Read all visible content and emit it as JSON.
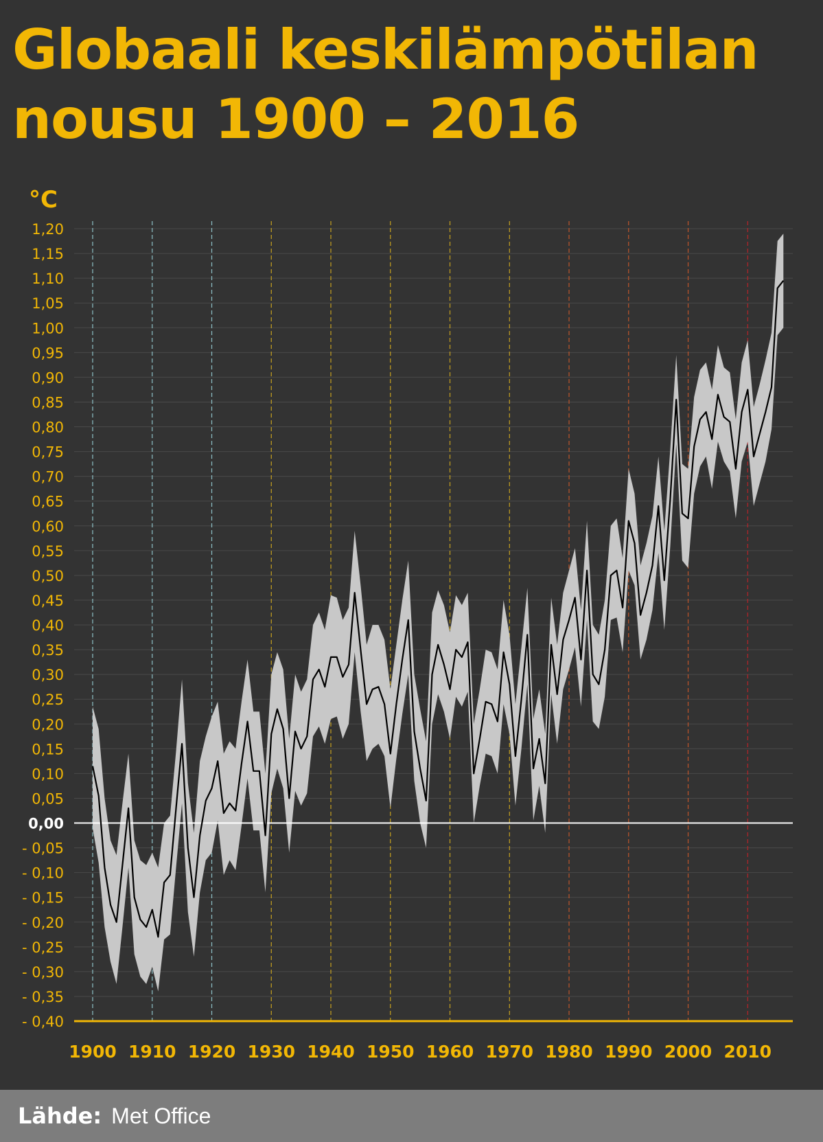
{
  "title": {
    "line1": "Globaali keskilämpötilan",
    "line2": "nousu 1900 – 2016"
  },
  "footer": {
    "source_label": "Lähde:",
    "source_value": "Met Office"
  },
  "colors": {
    "background": "#333333",
    "accent": "#f2b705",
    "band": "#c8c8c8",
    "line": "#000000",
    "zero_line": "#ffffff",
    "footer": "#7d7d7d"
  },
  "chart_data": {
    "type": "line",
    "ylabel": "°C",
    "ylim": [
      -0.4,
      1.2
    ],
    "xlim": [
      1900,
      2016
    ],
    "yticks": [
      {
        "v": 1.2,
        "label": "1,20"
      },
      {
        "v": 1.15,
        "label": "1,15"
      },
      {
        "v": 1.1,
        "label": "1,10"
      },
      {
        "v": 1.05,
        "label": "1,05"
      },
      {
        "v": 1.0,
        "label": "1,00"
      },
      {
        "v": 0.95,
        "label": "0,95"
      },
      {
        "v": 0.9,
        "label": "0,90"
      },
      {
        "v": 0.85,
        "label": "0,85"
      },
      {
        "v": 0.8,
        "label": "0,80"
      },
      {
        "v": 0.75,
        "label": "0,75"
      },
      {
        "v": 0.7,
        "label": "0,70"
      },
      {
        "v": 0.65,
        "label": "0,65"
      },
      {
        "v": 0.6,
        "label": "0,60"
      },
      {
        "v": 0.55,
        "label": "0,55"
      },
      {
        "v": 0.5,
        "label": "0,50"
      },
      {
        "v": 0.45,
        "label": "0,45"
      },
      {
        "v": 0.4,
        "label": "0,40"
      },
      {
        "v": 0.35,
        "label": "0,35"
      },
      {
        "v": 0.3,
        "label": "0,30"
      },
      {
        "v": 0.25,
        "label": "0,25"
      },
      {
        "v": 0.2,
        "label": "0,20"
      },
      {
        "v": 0.15,
        "label": "0,15"
      },
      {
        "v": 0.1,
        "label": "0,10"
      },
      {
        "v": 0.05,
        "label": "0,05"
      },
      {
        "v": 0.0,
        "label": "0,00"
      },
      {
        "v": -0.05,
        "label": "- 0,05"
      },
      {
        "v": -0.1,
        "label": "- 0,10"
      },
      {
        "v": -0.15,
        "label": "- 0,15"
      },
      {
        "v": -0.2,
        "label": "- 0,20"
      },
      {
        "v": -0.25,
        "label": "- 0,25"
      },
      {
        "v": -0.3,
        "label": "- 0,30"
      },
      {
        "v": -0.35,
        "label": "- 0,35"
      },
      {
        "v": -0.4,
        "label": "- 0,40"
      }
    ],
    "xticks": [
      {
        "v": 1900,
        "label": "1900",
        "color": "#8fc3c9"
      },
      {
        "v": 1910,
        "label": "1910",
        "color": "#8fc3c9"
      },
      {
        "v": 1920,
        "label": "1920",
        "color": "#8fc3c9"
      },
      {
        "v": 1930,
        "label": "1930",
        "color": "#c8a21f"
      },
      {
        "v": 1940,
        "label": "1940",
        "color": "#c8a21f"
      },
      {
        "v": 1950,
        "label": "1950",
        "color": "#c8a21f"
      },
      {
        "v": 1960,
        "label": "1960",
        "color": "#c8a21f"
      },
      {
        "v": 1970,
        "label": "1970",
        "color": "#c8a21f"
      },
      {
        "v": 1980,
        "label": "1980",
        "color": "#c0552a"
      },
      {
        "v": 1990,
        "label": "1990",
        "color": "#c0552a"
      },
      {
        "v": 2000,
        "label": "2000",
        "color": "#c0552a"
      },
      {
        "v": 2010,
        "label": "2010",
        "color": "#b8232a"
      }
    ],
    "grid": true,
    "series": [
      {
        "values": [
          [
            1900,
            0.115
          ],
          [
            1901,
            0.055
          ],
          [
            1902,
            -0.09
          ],
          [
            1903,
            -0.165
          ],
          [
            1904,
            -0.2
          ],
          [
            1905,
            -0.085
          ],
          [
            1906,
            0.03
          ],
          [
            1907,
            -0.15
          ],
          [
            1908,
            -0.195
          ],
          [
            1909,
            -0.21
          ],
          [
            1910,
            -0.175
          ],
          [
            1911,
            -0.23
          ],
          [
            1912,
            -0.12
          ],
          [
            1913,
            -0.105
          ],
          [
            1914,
            0.03
          ],
          [
            1915,
            0.16
          ],
          [
            1916,
            -0.05
          ],
          [
            1917,
            -0.15
          ],
          [
            1918,
            -0.025
          ],
          [
            1919,
            0.045
          ],
          [
            1920,
            0.07
          ],
          [
            1921,
            0.125
          ],
          [
            1922,
            0.02
          ],
          [
            1923,
            0.04
          ],
          [
            1924,
            0.025
          ],
          [
            1925,
            0.12
          ],
          [
            1926,
            0.205
          ],
          [
            1927,
            0.105
          ],
          [
            1928,
            0.105
          ],
          [
            1929,
            -0.025
          ],
          [
            1930,
            0.18
          ],
          [
            1931,
            0.23
          ],
          [
            1932,
            0.19
          ],
          [
            1933,
            0.05
          ],
          [
            1934,
            0.185
          ],
          [
            1935,
            0.15
          ],
          [
            1936,
            0.175
          ],
          [
            1937,
            0.29
          ],
          [
            1938,
            0.31
          ],
          [
            1939,
            0.275
          ],
          [
            1940,
            0.335
          ],
          [
            1941,
            0.335
          ],
          [
            1942,
            0.295
          ],
          [
            1943,
            0.32
          ],
          [
            1944,
            0.465
          ],
          [
            1945,
            0.35
          ],
          [
            1946,
            0.24
          ],
          [
            1947,
            0.27
          ],
          [
            1948,
            0.275
          ],
          [
            1949,
            0.24
          ],
          [
            1950,
            0.14
          ],
          [
            1951,
            0.24
          ],
          [
            1952,
            0.33
          ],
          [
            1953,
            0.41
          ],
          [
            1954,
            0.185
          ],
          [
            1955,
            0.11
          ],
          [
            1956,
            0.045
          ],
          [
            1957,
            0.3
          ],
          [
            1958,
            0.36
          ],
          [
            1959,
            0.32
          ],
          [
            1960,
            0.27
          ],
          [
            1961,
            0.35
          ],
          [
            1962,
            0.335
          ],
          [
            1963,
            0.365
          ],
          [
            1964,
            0.1
          ],
          [
            1965,
            0.17
          ],
          [
            1966,
            0.245
          ],
          [
            1967,
            0.24
          ],
          [
            1968,
            0.205
          ],
          [
            1969,
            0.345
          ],
          [
            1970,
            0.28
          ],
          [
            1971,
            0.135
          ],
          [
            1972,
            0.25
          ],
          [
            1973,
            0.38
          ],
          [
            1974,
            0.11
          ],
          [
            1975,
            0.17
          ],
          [
            1976,
            0.08
          ],
          [
            1977,
            0.36
          ],
          [
            1978,
            0.26
          ],
          [
            1979,
            0.37
          ],
          [
            1980,
            0.41
          ],
          [
            1981,
            0.455
          ],
          [
            1982,
            0.33
          ],
          [
            1983,
            0.51
          ],
          [
            1984,
            0.3
          ],
          [
            1985,
            0.28
          ],
          [
            1986,
            0.35
          ],
          [
            1987,
            0.5
          ],
          [
            1988,
            0.51
          ],
          [
            1989,
            0.435
          ],
          [
            1990,
            0.61
          ],
          [
            1991,
            0.565
          ],
          [
            1992,
            0.42
          ],
          [
            1993,
            0.465
          ],
          [
            1994,
            0.52
          ],
          [
            1995,
            0.64
          ],
          [
            1996,
            0.49
          ],
          [
            1997,
            0.655
          ],
          [
            1998,
            0.855
          ],
          [
            1999,
            0.625
          ],
          [
            2000,
            0.615
          ],
          [
            2001,
            0.76
          ],
          [
            2002,
            0.815
          ],
          [
            2003,
            0.83
          ],
          [
            2004,
            0.775
          ],
          [
            2005,
            0.865
          ],
          [
            2006,
            0.82
          ],
          [
            2007,
            0.81
          ],
          [
            2008,
            0.715
          ],
          [
            2009,
            0.83
          ],
          [
            2010,
            0.875
          ],
          [
            2011,
            0.74
          ],
          [
            2012,
            0.785
          ],
          [
            2013,
            0.83
          ],
          [
            2014,
            0.88
          ],
          [
            2015,
            1.08
          ],
          [
            2016,
            1.095
          ]
        ]
      }
    ],
    "uncertainty_band": {
      "upper": [
        0.235,
        0.19,
        0.05,
        -0.035,
        -0.065,
        0.04,
        0.14,
        -0.035,
        -0.075,
        -0.085,
        -0.06,
        -0.09,
        0.0,
        0.015,
        0.145,
        0.29,
        0.08,
        -0.02,
        0.125,
        0.175,
        0.215,
        0.245,
        0.14,
        0.165,
        0.15,
        0.245,
        0.33,
        0.225,
        0.225,
        0.1,
        0.3,
        0.345,
        0.31,
        0.17,
        0.3,
        0.265,
        0.29,
        0.4,
        0.425,
        0.39,
        0.46,
        0.455,
        0.41,
        0.435,
        0.59,
        0.48,
        0.36,
        0.4,
        0.4,
        0.37,
        0.27,
        0.36,
        0.45,
        0.53,
        0.3,
        0.23,
        0.165,
        0.425,
        0.47,
        0.44,
        0.385,
        0.46,
        0.44,
        0.465,
        0.2,
        0.27,
        0.35,
        0.345,
        0.31,
        0.45,
        0.38,
        0.24,
        0.355,
        0.475,
        0.21,
        0.27,
        0.18,
        0.455,
        0.36,
        0.465,
        0.51,
        0.555,
        0.43,
        0.61,
        0.4,
        0.38,
        0.45,
        0.6,
        0.615,
        0.535,
        0.715,
        0.665,
        0.52,
        0.565,
        0.62,
        0.74,
        0.59,
        0.755,
        0.945,
        0.725,
        0.715,
        0.86,
        0.915,
        0.93,
        0.875,
        0.965,
        0.92,
        0.91,
        0.815,
        0.93,
        0.975,
        0.84,
        0.885,
        0.935,
        0.99,
        1.175,
        1.19
      ],
      "lower": [
        -0.01,
        -0.08,
        -0.21,
        -0.28,
        -0.325,
        -0.21,
        -0.09,
        -0.265,
        -0.31,
        -0.325,
        -0.29,
        -0.34,
        -0.235,
        -0.225,
        -0.09,
        0.04,
        -0.18,
        -0.27,
        -0.14,
        -0.075,
        -0.06,
        0.005,
        -0.105,
        -0.075,
        -0.095,
        -0.005,
        0.09,
        -0.015,
        -0.015,
        -0.14,
        0.06,
        0.11,
        0.07,
        -0.06,
        0.065,
        0.035,
        0.06,
        0.175,
        0.195,
        0.16,
        0.21,
        0.215,
        0.17,
        0.2,
        0.345,
        0.225,
        0.125,
        0.15,
        0.16,
        0.135,
        0.03,
        0.13,
        0.22,
        0.3,
        0.085,
        0.0,
        -0.05,
        0.2,
        0.26,
        0.225,
        0.17,
        0.255,
        0.235,
        0.265,
        0.0,
        0.075,
        0.14,
        0.135,
        0.1,
        0.24,
        0.18,
        0.035,
        0.15,
        0.28,
        0.005,
        0.075,
        -0.02,
        0.26,
        0.16,
        0.27,
        0.31,
        0.355,
        0.235,
        0.41,
        0.205,
        0.19,
        0.255,
        0.41,
        0.415,
        0.345,
        0.51,
        0.48,
        0.33,
        0.37,
        0.43,
        0.545,
        0.39,
        0.56,
        0.765,
        0.53,
        0.515,
        0.665,
        0.72,
        0.74,
        0.675,
        0.77,
        0.73,
        0.71,
        0.615,
        0.73,
        0.77,
        0.64,
        0.685,
        0.73,
        0.795,
        0.985,
        1.0
      ]
    }
  }
}
